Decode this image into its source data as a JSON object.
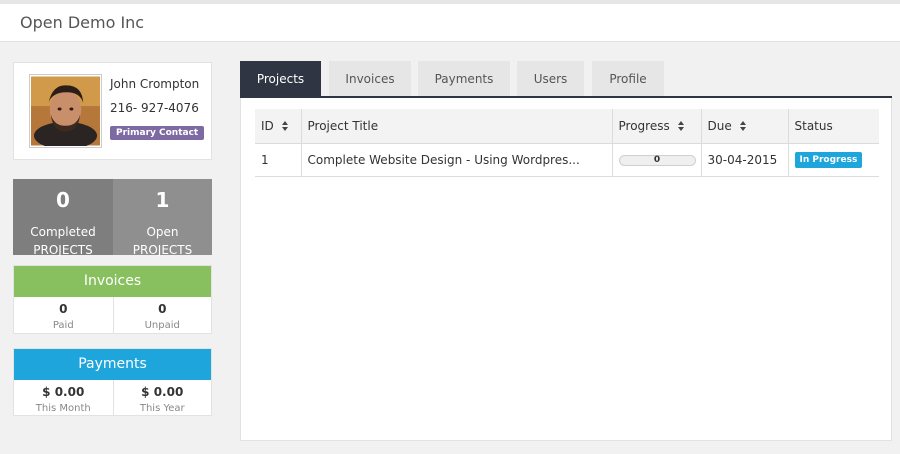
{
  "header": {
    "title": "Open Demo Inc"
  },
  "contact": {
    "name": "John Crompton",
    "phone": "216- 927-4076",
    "badge": "Primary Contact"
  },
  "project_stats": {
    "completed": {
      "count": "0",
      "label1": "Completed",
      "label2": "PROJECTS"
    },
    "open": {
      "count": "1",
      "label1": "Open",
      "label2": "PROJECTS"
    }
  },
  "invoices": {
    "title": "Invoices",
    "paid": {
      "value": "0",
      "label": "Paid"
    },
    "unpaid": {
      "value": "0",
      "label": "Unpaid"
    },
    "color": "#88c060"
  },
  "payments": {
    "title": "Payments",
    "this_month": {
      "value": "$ 0.00",
      "label": "This Month"
    },
    "this_year": {
      "value": "$ 0.00",
      "label": "This Year"
    },
    "color": "#1ea6dc"
  },
  "tabs": [
    {
      "label": "Projects",
      "active": true
    },
    {
      "label": "Invoices",
      "active": false
    },
    {
      "label": "Payments",
      "active": false
    },
    {
      "label": "Users",
      "active": false
    },
    {
      "label": "Profile",
      "active": false
    }
  ],
  "table": {
    "columns": [
      "ID",
      "Project Title",
      "Progress",
      "Due",
      "Status"
    ],
    "rows": [
      {
        "id": "1",
        "title": "Complete Website Design - Using Wordpres...",
        "progress": "0",
        "progress_value": 0,
        "due": "30-04-2015",
        "status": "In Progress"
      }
    ]
  },
  "colors": {
    "tab_active": "#2f3542",
    "primary_contact_badge": "#7e6aa3",
    "status_in_progress": "#1ea6dc"
  },
  "icons": [
    "sort-icon",
    "avatar-photo"
  ]
}
